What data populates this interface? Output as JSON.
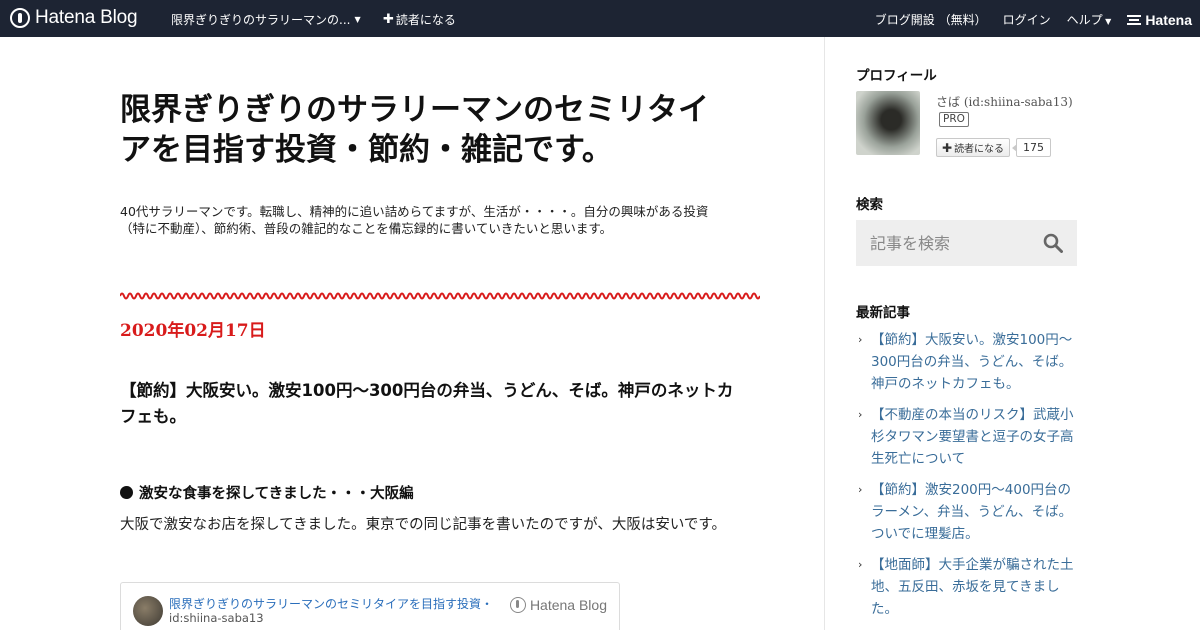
{
  "topbar": {
    "logo_text": "Hatena Blog",
    "blog_menu": "限界ぎりぎりのサラリーマンの...",
    "reader_label": "読者になる",
    "signup": "ブログ開設 （無料）",
    "login": "ログイン",
    "help": "ヘルプ",
    "brand": "Hatena",
    "bg_color": "#1d2433"
  },
  "blog": {
    "title": "限界ぎりぎりのサラリーマンのセミリタイアを目指す投資・節約・雑記です。",
    "description": "40代サラリーマンです。転職し、精神的に追い詰めらてますが、生活が・・・・。自分の興味がある投資（特に不動産）、節約術、普段の雑記的なことを備忘録的に書いていきたいと思います。"
  },
  "entry": {
    "date": "2020年02月17日",
    "date_color": "#d81b1b",
    "title": "【節約】大阪安い。激安100円～300円台の弁当、うどん、そば。神戸のネットカフェも。",
    "heading": "激安な食事を探してきました・・・大阪編",
    "body": "大阪で激安なお店を探してきました。東京での同じ記事を書いたのですが、大阪は安いです。",
    "embed": {
      "title": "限界ぎりぎりのサラリーマンのセミリタイアを目指す投資・",
      "sub": "id:shiina-saba13",
      "brand": "Hatena Blog"
    }
  },
  "sidebar": {
    "profile_heading": "プロフィール",
    "profile_name": "さば (id:shiina-saba13)",
    "pro_badge": "PRO",
    "follow_label": "読者になる",
    "follow_count": "175",
    "search_heading": "検索",
    "search_placeholder": "記事を検索",
    "recent_heading": "最新記事",
    "recent": [
      "【節約】大阪安い。激安100円～300円台の弁当、うどん、そば。神戸のネットカフェも。",
      "【不動産の本当のリスク】武蔵小杉タワマン要望書と逗子の女子高生死亡について",
      "【節約】激安200円～400円台のラーメン、弁当、うどん、そば。ついでに理髪店。",
      "【地面師】大手企業が騙された土地、五反田、赤坂を見てきました。"
    ],
    "link_color": "#3a6d99"
  }
}
